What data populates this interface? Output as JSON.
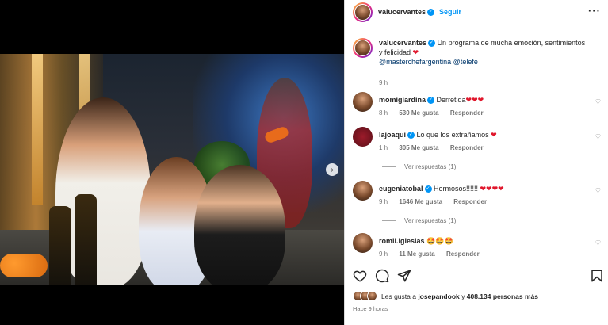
{
  "header": {
    "username": "valucervantes",
    "follow_label": "Seguir",
    "more_label": "···"
  },
  "caption": {
    "username": "valucervantes",
    "text": "Un programa de mucha emoción, sentimientos y felicidad ",
    "emoji": "❤",
    "mentions": "@masterchefargentina @telefe",
    "time": "9 h"
  },
  "comments": [
    {
      "username": "momigiardina",
      "verified": true,
      "text": "Derretida",
      "hearts": "❤❤❤",
      "time": "8 h",
      "likes": "530 Me gusta",
      "reply": "Responder",
      "replies": ""
    },
    {
      "username": "lajoaqui",
      "verified": true,
      "text": "Lo que los extrañamos ",
      "hearts": "❤",
      "time": "1 h",
      "likes": "305 Me gusta",
      "reply": "Responder",
      "replies": "Ver respuestas (1)"
    },
    {
      "username": "eugeniatobal",
      "verified": true,
      "text": "Hermosos!!!!!! ",
      "hearts": "❤❤❤❤",
      "time": "9 h",
      "likes": "1646 Me gusta",
      "reply": "Responder",
      "replies": "Ver respuestas (1)"
    },
    {
      "username": "romii.iglesias",
      "verified": false,
      "text": "",
      "hearts": "🤩🤩🤩",
      "time": "9 h",
      "likes": "11 Me gusta",
      "reply": "Responder",
      "replies": ""
    }
  ],
  "likes": {
    "prefix": "Les gusta a ",
    "user": "josepandook",
    "middle": " y ",
    "count": "408.134 personas más"
  },
  "time_ago": "Hace 9 horas",
  "colors": {
    "accent": "#0095f6",
    "heart": "#e0162b",
    "muted": "#737373"
  },
  "icons": [
    "heart-icon",
    "comment-icon",
    "share-icon",
    "bookmark-icon",
    "more-icon",
    "next-arrow-icon",
    "verified-icon"
  ]
}
